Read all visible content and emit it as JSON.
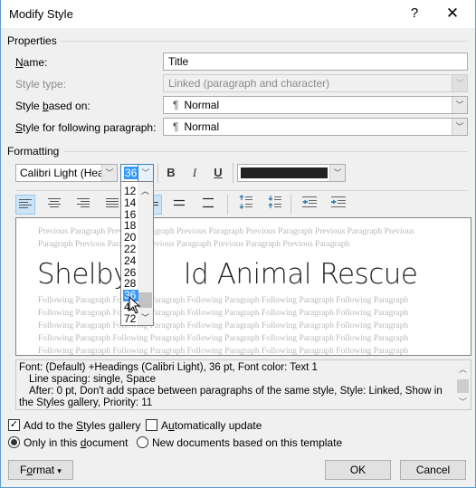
{
  "window": {
    "title": "Modify Style",
    "help_label": "?",
    "close_label": "✕"
  },
  "properties": {
    "section_label": "Properties",
    "name": {
      "label": "Name:",
      "value": "Title"
    },
    "style_type": {
      "label": "Style type:",
      "value": "Linked (paragraph and character)"
    },
    "based_on": {
      "label": "Style based on:",
      "value": "Normal",
      "icon": "¶"
    },
    "following": {
      "label": "Style for following paragraph:",
      "value": "Normal",
      "icon": "¶"
    }
  },
  "formatting": {
    "section_label": "Formatting",
    "font": "Calibri Light (Headings)",
    "font_visible": "Calibri Light (Head",
    "size": "36",
    "bold_label": "B",
    "italic_label": "I",
    "underline_label": "U",
    "font_color": "#222222",
    "size_options": [
      "12",
      "14",
      "16",
      "18",
      "20",
      "22",
      "24",
      "26",
      "28",
      "36",
      "48",
      "72"
    ],
    "size_selected": "36"
  },
  "preview": {
    "previous_lines": [
      "Previous Paragraph Previous Paragraph Previous Paragraph Previous Paragraph Previous Paragraph Previous",
      "Paragraph Previous Paragraph Previous Paragraph Previous Paragraph Previous Paragraph"
    ],
    "title_left": "Shelby",
    "title_right": "ld Animal Rescue",
    "following_line": "Following Paragraph Following Paragraph Following Paragraph Following Paragraph Following Paragraph"
  },
  "description": {
    "line1": "Font: (Default) +Headings (Calibri Light), 36 pt, Font color: Text 1",
    "line2": "Line spacing:  single, Space",
    "line3": "After:  0 pt, Don't add space between paragraphs of the same style, Style: Linked, Show in",
    "line4": "the Styles gallery, Priority: 11"
  },
  "options": {
    "add_gallery": {
      "label_pre": "Add to the ",
      "label_u": "S",
      "label_post": "tyles gallery",
      "checked": true
    },
    "auto_update": {
      "label_pre": "A",
      "label_u": "u",
      "label_post": "tomatically update",
      "checked": false
    },
    "only_doc": {
      "label_pre": "Only in this ",
      "label_u": "d",
      "label_post": "ocument",
      "selected": true
    },
    "new_docs": {
      "label": "New documents based on this template",
      "selected": false
    }
  },
  "buttons": {
    "format_pre": "F",
    "format_u": "o",
    "format_post": "rmat",
    "format_arrow": "▾",
    "ok": "OK",
    "cancel": "Cancel"
  }
}
